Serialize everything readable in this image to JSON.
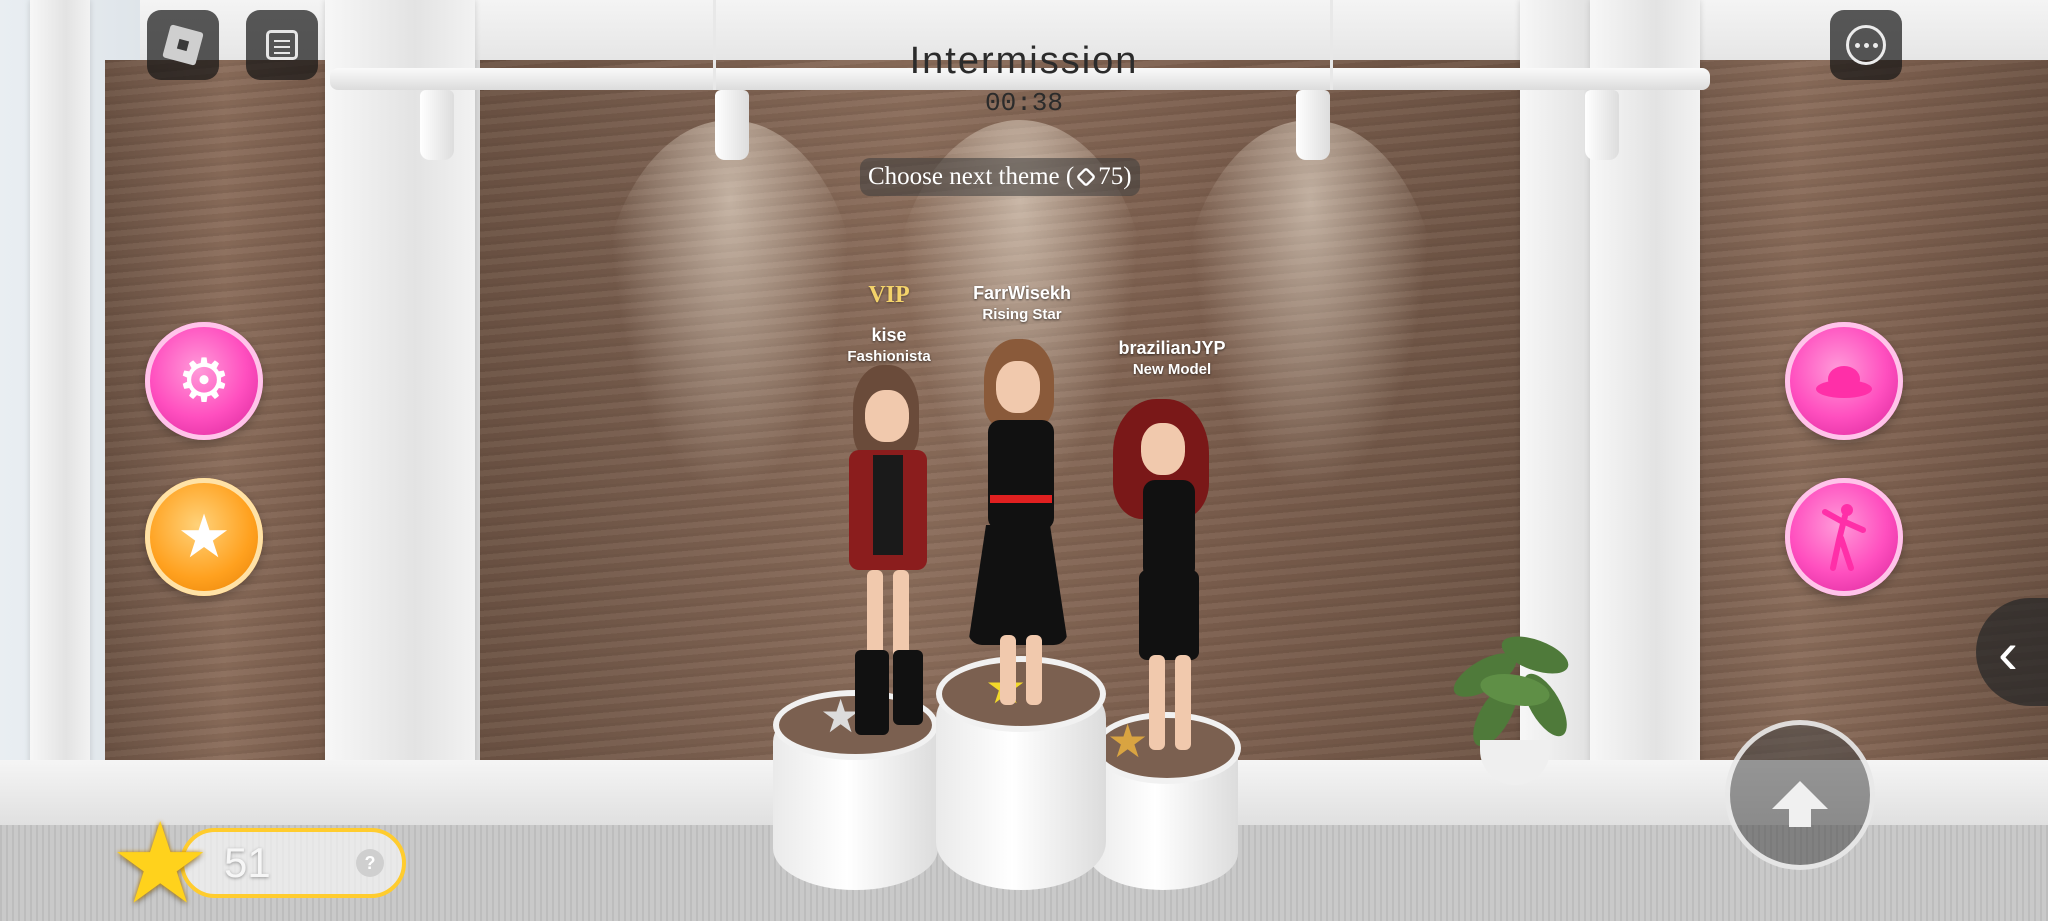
{
  "hud": {
    "roblox_menu_icon": "roblox-logo-icon",
    "chat_icon": "chat-icon",
    "more_icon": "more-options-icon",
    "title": "Intermission",
    "timer": "00:38",
    "theme_button": {
      "label": "Choose next theme (",
      "amount": "75)"
    }
  },
  "left_buttons": [
    {
      "icon": "gear-icon",
      "color": "#ff4fbf"
    },
    {
      "icon": "star-icon",
      "color": "#ffa11f"
    }
  ],
  "right_buttons": [
    {
      "icon": "hat-icon",
      "color": "#ff4fbf"
    },
    {
      "icon": "pose-icon",
      "color": "#ff4fbf"
    }
  ],
  "players": [
    {
      "badge": "VIP",
      "name": "kise",
      "rank": "Fashionista"
    },
    {
      "name": "FarrWisekh",
      "rank": "Rising Star"
    },
    {
      "name": "brazilianJYP",
      "rank": "New Model"
    }
  ],
  "points": {
    "value": "51",
    "help": "?"
  },
  "controls": {
    "side_tab_icon": "chevron-left-icon",
    "jump_icon": "jump-arrow-icon"
  }
}
